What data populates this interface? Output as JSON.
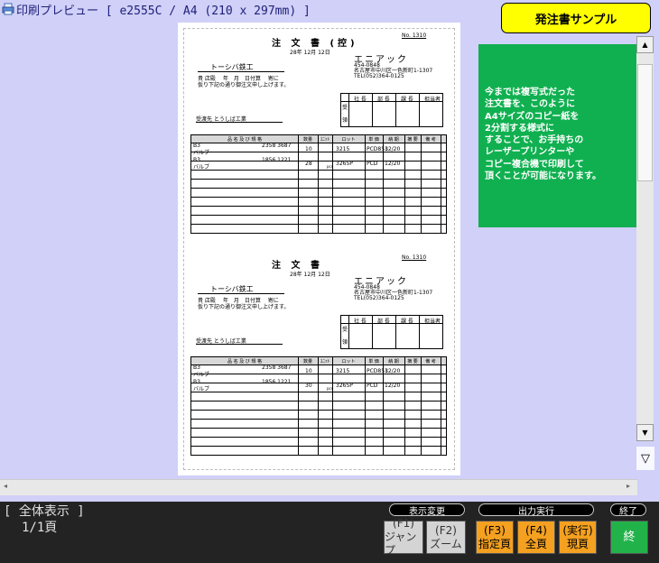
{
  "window": {
    "title": "印刷プレビュー [ e2555C / A4 (210 x 297mm) ]"
  },
  "sample_button": {
    "label": "発注書サンプル"
  },
  "note": {
    "text": "今までは複写式だった\n注文書を、このように\nA4サイズのコピー紙を\n2分割する様式に\nすることで、お手持ちの\nレーザープリンターや\nコピー複合機で印刷して\n頂くことが可能になります。"
  },
  "orders": [
    {
      "number": "No. 1310",
      "title": "注 文 書 (控)",
      "date": "28年 12月 12日",
      "company_name": "エニアック",
      "company_address": "454-0848\n名古屋市中川区一色新町1-1307\nTEL(052)364-0125",
      "customer": "トーシバ鉄工",
      "intro": "貴 店殿　 年　月　日付算　 寄に\n仮り下記の通り御注文申し上げます。",
      "delivery": "受渡先 とうしばエ業",
      "stamp_headers": [
        "社 長",
        "部 長",
        "課 長",
        "担当者"
      ],
      "stamp_side": [
        "受",
        "領"
      ],
      "table_headers": [
        "品 名 及 び 規 格",
        "数量",
        "ﾕﾆｯﾄ",
        "ロット",
        "単 価",
        "納 期",
        "摘 要",
        "備 考"
      ],
      "rows": [
        {
          "code": "B3",
          "name": "バルブ",
          "spec": "2358 3687",
          "qty": "10",
          "unit": "",
          "lot": "3215",
          "price": "PCD853",
          "due": "12/20"
        },
        {
          "code": "B3",
          "name": "バルブ",
          "spec": "1856 1221",
          "qty": "28",
          "unit": "pcs",
          "lot": "3265P",
          "price": "PCD",
          "due": "12/20"
        }
      ]
    },
    {
      "number": "No. 1310",
      "title": "注 文 書",
      "date": "28年 12月 12日",
      "company_name": "エニアック",
      "company_address": "454-0848\n名古屋市中川区一色新町1-1307\nTEL(052)364-0125",
      "customer": "トーシバ鉄工",
      "intro": "貴 店殿　 年　月　日付算　 寄に\n仮り下記の通り御注文申し上げます。",
      "delivery": "受渡先 とうしばエ業",
      "stamp_headers": [
        "社 長",
        "部 長",
        "課 長",
        "担当者"
      ],
      "stamp_side": [
        "受",
        "領"
      ],
      "table_headers": [
        "品 名 及 び 規 格",
        "数量",
        "ﾕﾆｯﾄ",
        "ロット",
        "単 価",
        "納 期",
        "摘 要",
        "備 考"
      ],
      "rows": [
        {
          "code": "B3",
          "name": "バルブ",
          "spec": "2358 3687",
          "qty": "10",
          "unit": "",
          "lot": "3215",
          "price": "PCD853",
          "due": "12/20"
        },
        {
          "code": "B3",
          "name": "バルブ",
          "spec": "1856 1221",
          "qty": "30",
          "unit": "pcs",
          "lot": "3265P",
          "price": "PCD",
          "due": "12/20"
        }
      ]
    }
  ],
  "status": {
    "mode": "[ 全体表示 ]",
    "page": "1/1頁"
  },
  "groups": {
    "display_change": "表示変更",
    "output_run": "出力実行",
    "exit": "終了"
  },
  "buttons": {
    "f1": {
      "key": "(F1)",
      "label": "ジャンプ"
    },
    "f2": {
      "key": "(F2)",
      "label": "ズーム"
    },
    "f3": {
      "key": "(F3)",
      "label": "指定頁"
    },
    "f4": {
      "key": "(F4)",
      "label": "全頁"
    },
    "run": {
      "key": "(実行)",
      "label": "現頁"
    },
    "end": {
      "label": "終"
    }
  },
  "colors": {
    "background": "#d0d0f8",
    "sample_button": "#ffff00",
    "note": "#10b050",
    "bottom_bar": "#232323",
    "gray_button": "#d4d4d4",
    "orange_button": "#f4a020",
    "green_button": "#22b24a"
  },
  "icons": {
    "app": "printer-icon",
    "scroll_up": "triangle-up-icon",
    "scroll_down": "triangle-down-icon",
    "collapse": "triangle-down-outline-icon"
  }
}
